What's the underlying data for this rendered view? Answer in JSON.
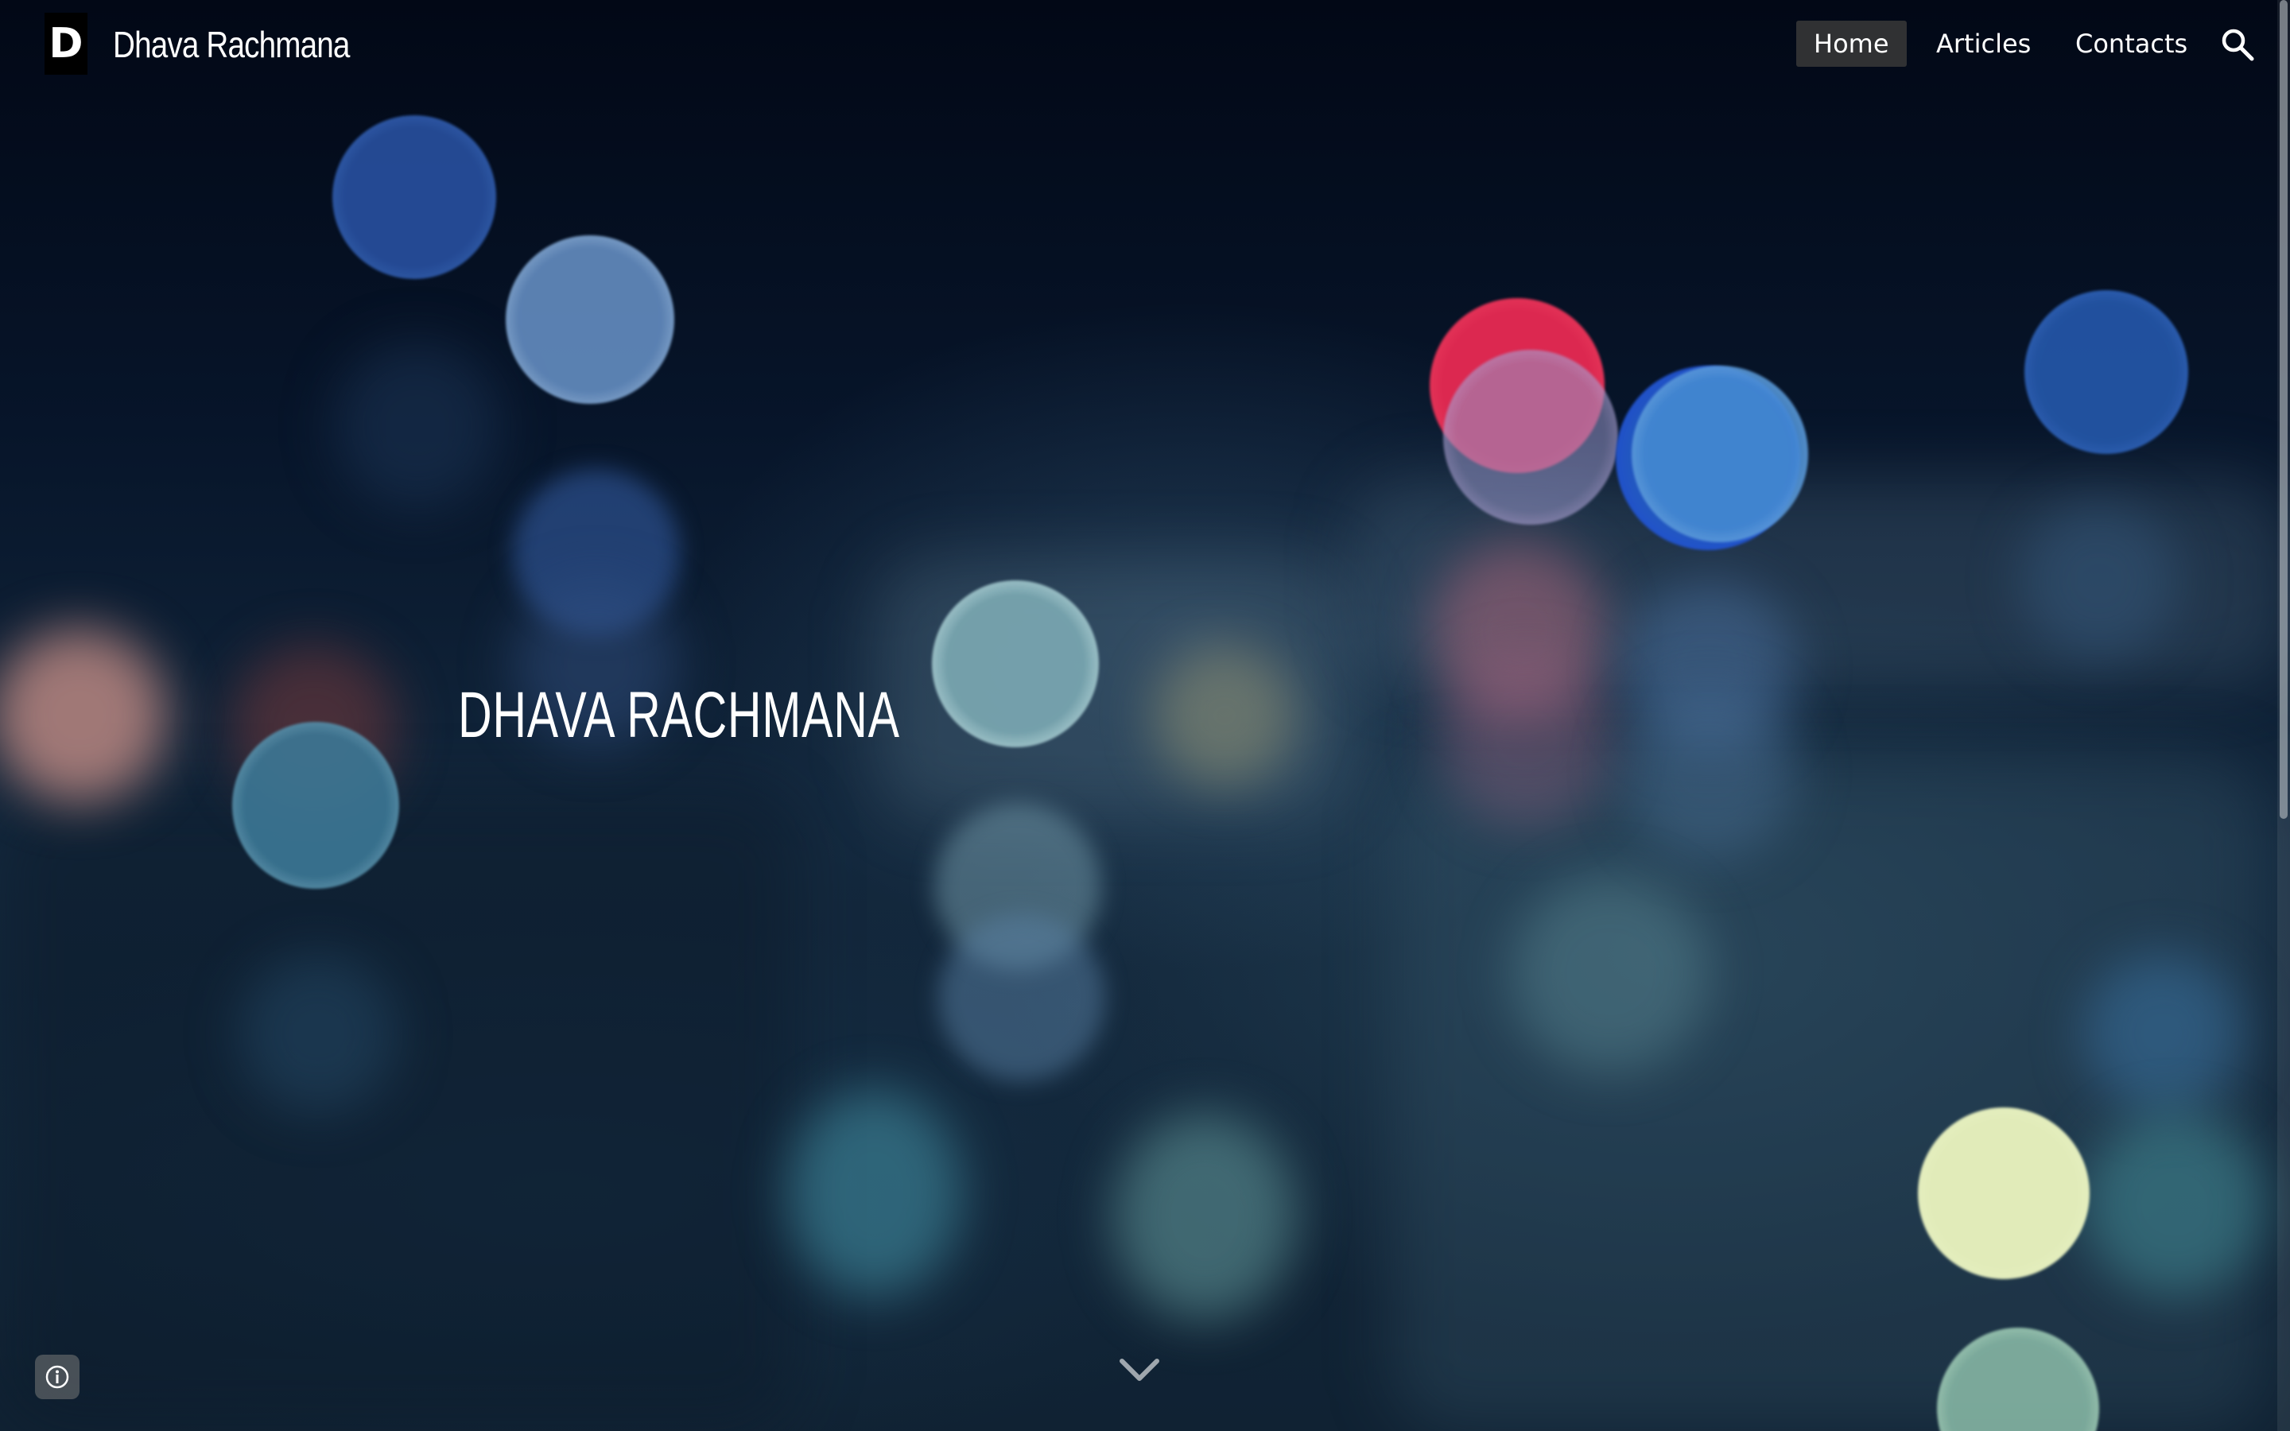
{
  "site": {
    "logo_letter": "D",
    "title": "Dhava Rachmana"
  },
  "nav": {
    "items": [
      {
        "label": "Home",
        "active": true
      },
      {
        "label": "Articles",
        "active": false
      },
      {
        "label": "Contacts",
        "active": false
      }
    ],
    "search_icon": "search-icon"
  },
  "hero": {
    "heading": "DHAVA RACHMANA",
    "scroll_icon": "chevron-down-icon"
  },
  "footer": {
    "info_icon": "info-icon"
  },
  "colors": {
    "background": "#06111f",
    "active_nav_bg": "#383838",
    "text": "#ffffff"
  }
}
